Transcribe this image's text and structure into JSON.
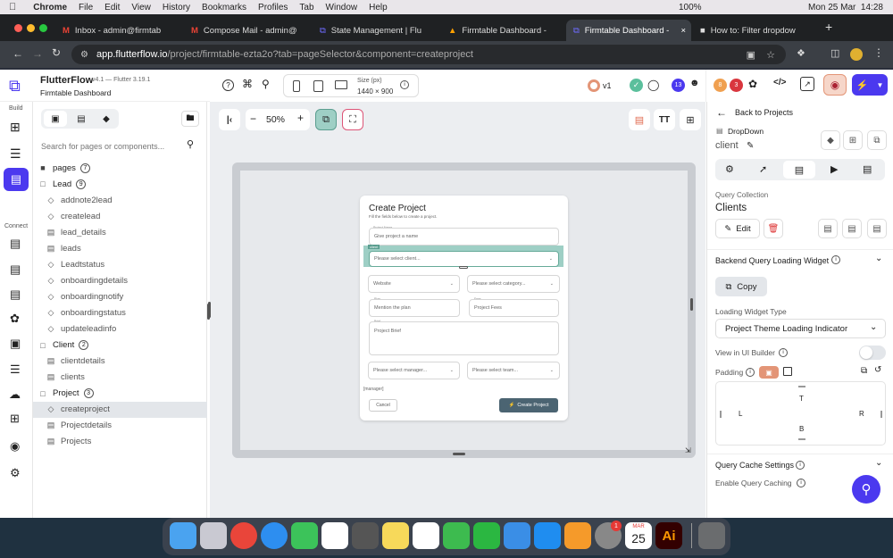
{
  "menubar": {
    "items": [
      "Chrome",
      "File",
      "Edit",
      "View",
      "History",
      "Bookmarks",
      "Profiles",
      "Tab",
      "Window",
      "Help"
    ],
    "battery": "100%",
    "datetime": "Mon 25 Mar  14:28"
  },
  "tabs": [
    {
      "label": "Inbox - admin@firmtab"
    },
    {
      "label": "Compose Mail - admin@"
    },
    {
      "label": "State Management | Flu"
    },
    {
      "label": "Firmtable Dashboard - "
    },
    {
      "label": "Firmtable Dashboard - "
    },
    {
      "label": "How to: Filter dropdow"
    }
  ],
  "url": {
    "domain": "app.flutterflow.io",
    "path": "/project/firmtable-ezta2o?tab=pageSelector&component=createproject"
  },
  "app": {
    "name": "FlutterFlow",
    "version": "v4.1 — Flutter 3.19.1",
    "project": "Firmtable Dashboard"
  },
  "rail": {
    "build": "Build",
    "connect": "Connect"
  },
  "search": {
    "placeholder": "Search for pages or components..."
  },
  "tree": [
    {
      "label": "pages",
      "count": "7",
      "kind": "folder",
      "indent": 0
    },
    {
      "label": "Lead",
      "count": "9",
      "kind": "folder-open",
      "indent": 0
    },
    {
      "label": "addnote2lead",
      "kind": "component",
      "indent": 1
    },
    {
      "label": "createlead",
      "kind": "component",
      "indent": 1
    },
    {
      "label": "lead_details",
      "kind": "page",
      "indent": 1
    },
    {
      "label": "leads",
      "kind": "page",
      "indent": 1
    },
    {
      "label": "Leadtstatus",
      "kind": "component",
      "indent": 1
    },
    {
      "label": "onboardingdetails",
      "kind": "component",
      "indent": 1
    },
    {
      "label": "onboardingnotify",
      "kind": "component",
      "indent": 1
    },
    {
      "label": "onboardingstatus",
      "kind": "component",
      "indent": 1
    },
    {
      "label": "updateleadinfo",
      "kind": "component",
      "indent": 1
    },
    {
      "label": "Client",
      "count": "2",
      "kind": "folder-open",
      "indent": 0
    },
    {
      "label": "clientdetails",
      "kind": "page",
      "indent": 1
    },
    {
      "label": "clients",
      "kind": "page",
      "indent": 1
    },
    {
      "label": "Project",
      "count": "3",
      "kind": "folder-open",
      "indent": 0
    },
    {
      "label": "createproject",
      "kind": "component",
      "indent": 1,
      "selected": true
    },
    {
      "label": "Projectdetails",
      "kind": "page",
      "indent": 1
    },
    {
      "label": "Projects",
      "kind": "page",
      "indent": 1
    }
  ],
  "toolbar": {
    "size_label": "Size (px)",
    "size_value": "1440 × 900",
    "zoom": "50%",
    "version": "v1",
    "badge_13": "13",
    "badge_8": "8",
    "badge_3": "3"
  },
  "form": {
    "title": "Create Project",
    "subtitle": "Fill the fields below to create a project.",
    "project_name_label": "Project Name",
    "project_name_placeholder": "Give project a name",
    "client_tag": "client",
    "client_placeholder": "Please select client...",
    "website": "Website",
    "category_placeholder": "Please select category...",
    "plan_label": "Plan",
    "plan_placeholder": "Mention the plan",
    "fees_label": "Fees",
    "fees_placeholder": "Project Fees",
    "brief_label": "Brief",
    "brief_placeholder": "Project Brief",
    "manager_placeholder": "Please select manager...",
    "team_placeholder": "Please select team...",
    "manager_tag": "[manager]",
    "cancel": "Cancel",
    "create": "Create Project"
  },
  "right": {
    "back": "Back to Projects",
    "widget_type": "DropDown",
    "widget_name": "client",
    "query_collection_label": "Query Collection",
    "query_collection_value": "Clients",
    "edit": "Edit",
    "backend_loading": "Backend Query Loading Widget",
    "copy": "Copy",
    "loading_type_label": "Loading Widget Type",
    "loading_type_value": "Project Theme Loading Indicator",
    "view_ui_builder": "View in UI Builder",
    "padding": "Padding",
    "pad_t": "T",
    "pad_l": "L",
    "pad_r": "R",
    "pad_b": "B",
    "cache_settings": "Query Cache Settings",
    "enable_cache": "Enable Query Caching"
  },
  "dock": {
    "calendar_month": "MAR",
    "calendar_day": "25",
    "notif": "1"
  },
  "colors": {
    "accent": "#4b39ef",
    "selected": "#e3e6ea",
    "create_btn": "#4b6472",
    "teal": "#9ecfc5"
  }
}
